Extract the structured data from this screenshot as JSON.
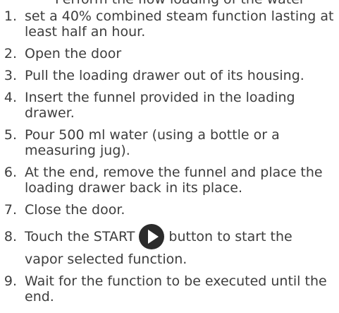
{
  "clipped_line": "Perform the flow loading of the water",
  "steps": [
    {
      "num": "1.",
      "text": "set a 40% combined steam function lasting at least half an hour."
    },
    {
      "num": "2.",
      "text": "Open the door"
    },
    {
      "num": "3.",
      "text": "Pull the loading drawer out of its housing."
    },
    {
      "num": "4.",
      "text": "Insert the funnel provided in the loading drawer."
    },
    {
      "num": "5.",
      "text": "Pour 500 ml water (using a bottle or a measuring jug)."
    },
    {
      "num": "6.",
      "text": "At the end, remove the funnel and place the loading drawer back in its place."
    },
    {
      "num": "7.",
      "text": "Close the door."
    },
    {
      "num": "8.",
      "text_before": "Touch the START",
      "text_after": "button to start the",
      "text_cont": "vapor selected function."
    },
    {
      "num": "9.",
      "text": "Wait for the function to be executed until the end."
    }
  ],
  "icons": {
    "start_icon": "play-icon",
    "start_icon_color": "#2b2b2b"
  }
}
